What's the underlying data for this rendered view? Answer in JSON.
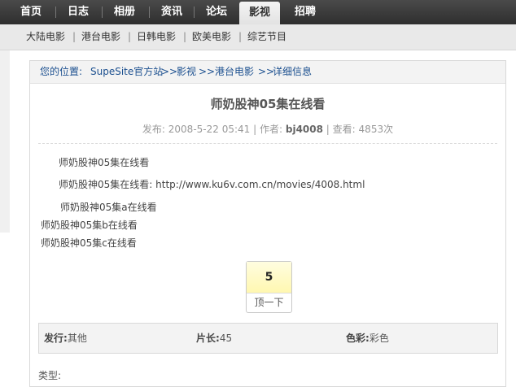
{
  "nav": {
    "items": [
      {
        "label": "首页"
      },
      {
        "label": "日志"
      },
      {
        "label": "相册"
      },
      {
        "label": "资讯"
      },
      {
        "label": "论坛"
      },
      {
        "label": "影视"
      },
      {
        "label": "招聘"
      }
    ],
    "active_index": 5
  },
  "subnav": {
    "items": [
      {
        "label": "大陆电影"
      },
      {
        "label": "港台电影"
      },
      {
        "label": "日韩电影"
      },
      {
        "label": "欧美电影"
      },
      {
        "label": "综艺节目"
      }
    ],
    "separator": "|"
  },
  "breadcrumb": {
    "prefix": "您的位置:",
    "items": [
      "SupeSite官方站",
      "影视",
      "港台电影",
      "详细信息"
    ],
    "separator": ">>"
  },
  "article": {
    "title": "师奶股神05集在线看",
    "meta": {
      "published_label": "发布:",
      "published": "2008-5-22 05:41",
      "author_label": "作者:",
      "author": "bj4008",
      "views_label": "查看:",
      "views": "4853次",
      "sep": "|"
    },
    "paragraphs": [
      "师奶股神05集在线看",
      "师奶股神05集在线看:"
    ],
    "link": "http://www.ku6v.com.cn/movies/4008.html",
    "lines": [
      "师奶股神05集a在线看",
      "师奶股神05集b在线看",
      "师奶股神05集c在线看"
    ]
  },
  "vote": {
    "count": "5",
    "label": "顶一下"
  },
  "info": {
    "issuer_label": "发行:",
    "issuer": "其他",
    "length_label": "片长:",
    "length": "45",
    "color_label": "色彩:",
    "color": "彩色"
  },
  "cutoff_text": "类型:"
}
